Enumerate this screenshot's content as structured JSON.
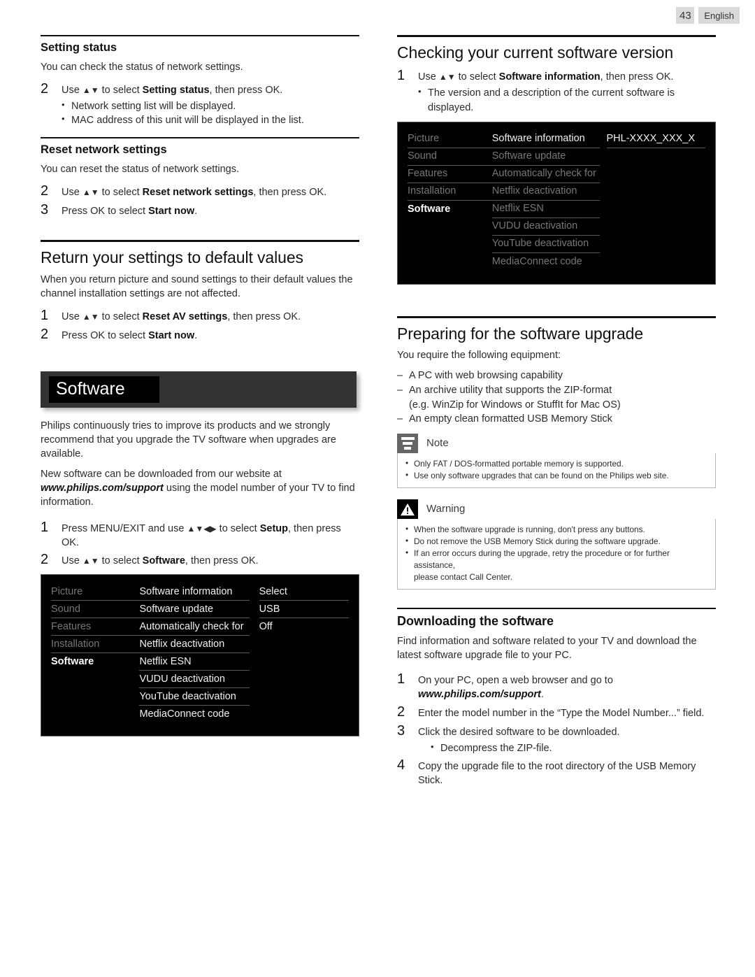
{
  "header": {
    "page_number": "43",
    "language": "English"
  },
  "left_column": {
    "setting_status": {
      "heading": "Setting status",
      "intro": "You can check the status of network settings.",
      "steps": [
        {
          "num": "2",
          "pre": "Use ",
          "arrows": "▲▼",
          "mid": " to select ",
          "bold": "Setting status",
          "post": ", then press OK."
        }
      ],
      "bullets": [
        "Network setting list will be displayed.",
        "MAC address of this unit will be displayed in the list."
      ]
    },
    "reset_network": {
      "heading": "Reset network settings",
      "intro": "You can reset the status of network settings.",
      "steps": [
        {
          "num": "2",
          "pre": "Use ",
          "arrows": "▲▼",
          "mid": " to select ",
          "bold": "Reset network settings",
          "post": ", then press OK."
        },
        {
          "num": "3",
          "pre": "Press OK to select ",
          "arrows": "",
          "mid": "",
          "bold": "Start now",
          "post": "."
        }
      ]
    },
    "return_defaults": {
      "heading": "Return your settings to default values",
      "intro": "When you return picture and sound settings to their default values the channel installation settings are not affected.",
      "steps": [
        {
          "num": "1",
          "pre": "Use ",
          "arrows": "▲▼",
          "mid": " to select ",
          "bold": "Reset AV settings",
          "post": ", then press OK."
        },
        {
          "num": "2",
          "pre": "Press OK to select ",
          "arrows": "",
          "mid": "",
          "bold": "Start now",
          "post": "."
        }
      ]
    },
    "software_banner": {
      "title": "Software"
    },
    "software_intro": {
      "para1": "Philips continuously tries to improve its products and we strongly recommend that you upgrade the TV software when upgrades are available.",
      "para2_a": "New software can be downloaded from our website at ",
      "para2_url": "www.philips.com/support",
      "para2_b": " using the model number of your TV to find information.",
      "steps": [
        {
          "num": "1",
          "pre": "Press MENU/EXIT and use ",
          "arrows": "▲▼◀▶",
          "mid": " to select ",
          "bold": "Setup",
          "post": ", then press OK."
        },
        {
          "num": "2",
          "pre": "Use ",
          "arrows": "▲▼",
          "mid": " to select ",
          "bold": "Software",
          "post": ", then press OK."
        }
      ]
    },
    "tv_menu": {
      "col1": [
        {
          "label": "Picture",
          "state": "dim"
        },
        {
          "label": "Sound",
          "state": "dim"
        },
        {
          "label": "Features",
          "state": "dim"
        },
        {
          "label": "Installation",
          "state": "dim"
        },
        {
          "label": "Software",
          "state": "on"
        }
      ],
      "col2": [
        {
          "label": "Software information",
          "state": "bright"
        },
        {
          "label": "Software update",
          "state": "bright"
        },
        {
          "label": "Automatically check for",
          "state": "bright"
        },
        {
          "label": "Netflix deactivation",
          "state": "bright"
        },
        {
          "label": "Netflix ESN",
          "state": "bright"
        },
        {
          "label": "VUDU deactivation",
          "state": "bright"
        },
        {
          "label": "YouTube deactivation",
          "state": "bright"
        },
        {
          "label": "MediaConnect code",
          "state": "bright"
        }
      ],
      "col3": [
        {
          "label": "Select",
          "state": "bright"
        },
        {
          "label": "USB",
          "state": "bright"
        },
        {
          "label": "Off",
          "state": "bright"
        }
      ]
    }
  },
  "right_column": {
    "checking_version": {
      "heading": "Checking your current software version",
      "steps": [
        {
          "num": "1",
          "pre": "Use ",
          "arrows": "▲▼",
          "mid": " to select ",
          "bold": "Software information",
          "post": ", then press OK."
        }
      ],
      "bullets": [
        "The version and a description of the current software is displayed."
      ]
    },
    "tv_menu": {
      "col1": [
        {
          "label": "Picture",
          "state": "dim"
        },
        {
          "label": "Sound",
          "state": "dim"
        },
        {
          "label": "Features",
          "state": "dim"
        },
        {
          "label": "Installation",
          "state": "dim"
        },
        {
          "label": "Software",
          "state": "on"
        }
      ],
      "col2": [
        {
          "label": "Software information",
          "state": "bright"
        },
        {
          "label": "Software update",
          "state": "dim"
        },
        {
          "label": "Automatically check for",
          "state": "dim"
        },
        {
          "label": "Netflix deactivation",
          "state": "dim"
        },
        {
          "label": "Netflix ESN",
          "state": "dim"
        },
        {
          "label": "VUDU deactivation",
          "state": "dim"
        },
        {
          "label": "YouTube deactivation",
          "state": "dim"
        },
        {
          "label": "MediaConnect code",
          "state": "dim"
        }
      ],
      "col3": [
        {
          "label": "PHL-XXXX_XXX_X",
          "state": "bright"
        }
      ]
    },
    "preparing": {
      "heading": "Preparing for the software upgrade",
      "intro": "You require the following equipment:",
      "requirements": [
        {
          "line1": "A PC with web browsing capability",
          "line2": ""
        },
        {
          "line1": "An archive utility that supports the ZIP-format",
          "line2": "(e.g. WinZip for Windows or StuffIt for Mac OS)"
        },
        {
          "line1": "An empty clean formatted USB Memory Stick",
          "line2": ""
        }
      ]
    },
    "note": {
      "label": "Note",
      "items": [
        {
          "line1": "Only FAT / DOS-formatted portable memory is supported.",
          "line2": ""
        },
        {
          "line1": "Use only software upgrades that can be found on the Philips web site.",
          "line2": ""
        }
      ]
    },
    "warning": {
      "label": "Warning",
      "items": [
        {
          "line1": "When the software upgrade is running, don't press any buttons.",
          "line2": ""
        },
        {
          "line1": "Do not remove the USB Memory Stick during the software upgrade.",
          "line2": ""
        },
        {
          "line1": "If an error occurs during the upgrade, retry the procedure or for further assistance,",
          "line2": "please contact Call Center."
        }
      ]
    },
    "downloading": {
      "heading": "Downloading the software",
      "intro": "Find information and software related to your TV and download the latest software upgrade file to your PC.",
      "steps": [
        {
          "num": "1",
          "pre": "On your PC, open a web browser and go to ",
          "url": "www.philips.com/support",
          "post": "."
        },
        {
          "num": "2",
          "pre": "Enter the model number in the “Type the Model Number...” field.",
          "url": "",
          "post": ""
        },
        {
          "num": "3",
          "pre": "Click the desired software to be downloaded.",
          "url": "",
          "post": ""
        },
        {
          "num": "4",
          "pre": "Copy the upgrade file to the root directory of the USB Memory Stick.",
          "url": "",
          "post": ""
        }
      ],
      "sub_bullet": "Decompress the ZIP-file."
    }
  }
}
